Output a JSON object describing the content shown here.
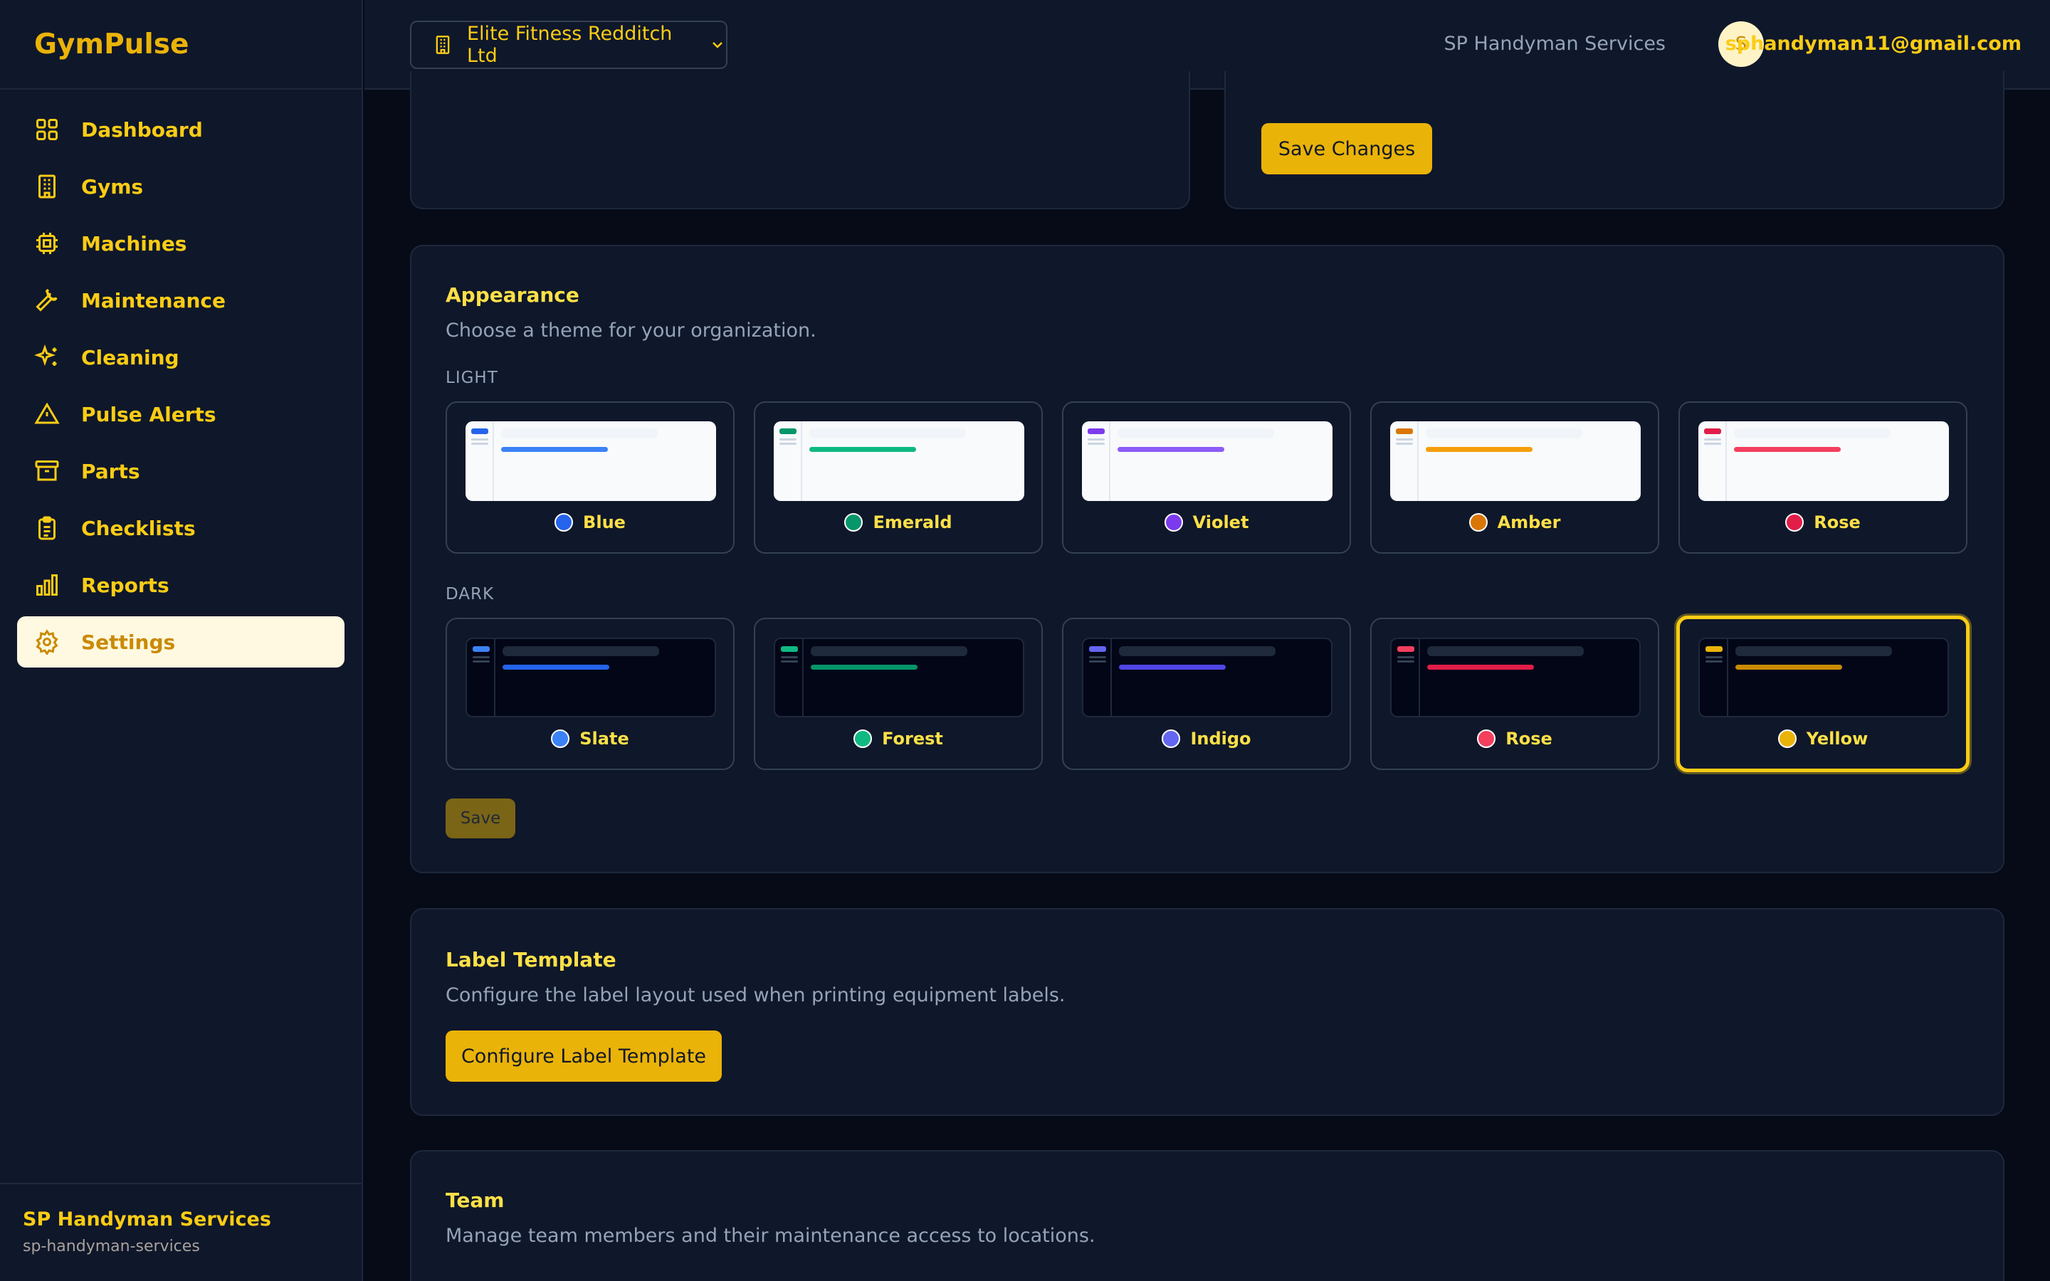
{
  "app": {
    "name": "GymPulse"
  },
  "sidebar": {
    "items": [
      {
        "label": "Dashboard",
        "icon": "grid-icon"
      },
      {
        "label": "Gyms",
        "icon": "building-icon"
      },
      {
        "label": "Machines",
        "icon": "cpu-icon"
      },
      {
        "label": "Maintenance",
        "icon": "wrench-icon"
      },
      {
        "label": "Cleaning",
        "icon": "sparkles-icon"
      },
      {
        "label": "Pulse Alerts",
        "icon": "alert-triangle-icon"
      },
      {
        "label": "Parts",
        "icon": "archive-icon"
      },
      {
        "label": "Checklists",
        "icon": "clipboard-icon"
      },
      {
        "label": "Reports",
        "icon": "bar-chart-icon"
      },
      {
        "label": "Settings",
        "icon": "gear-icon",
        "active": true
      }
    ],
    "footer": {
      "name": "SP Handyman Services",
      "slug": "sp-handyman-services"
    }
  },
  "header": {
    "org_selector": "Elite Fitness Redditch Ltd",
    "company": "SP Handyman Services",
    "avatar_initial": "S",
    "email": "sphandyman11@gmail.com"
  },
  "profile_card": {
    "save_label": "Save Changes"
  },
  "appearance": {
    "title": "Appearance",
    "description": "Choose a theme for your organization.",
    "light_label": "LIGHT",
    "dark_label": "DARK",
    "light_themes": [
      {
        "name": "Blue",
        "color": "#2563eb",
        "bar": "#3b82f6"
      },
      {
        "name": "Emerald",
        "color": "#059669",
        "bar": "#10b981"
      },
      {
        "name": "Violet",
        "color": "#7c3aed",
        "bar": "#8b5cf6"
      },
      {
        "name": "Amber",
        "color": "#d97706",
        "bar": "#f59e0b"
      },
      {
        "name": "Rose",
        "color": "#e11d48",
        "bar": "#f43f5e"
      }
    ],
    "dark_themes": [
      {
        "name": "Slate",
        "color": "#3b82f6",
        "bar": "#2563eb"
      },
      {
        "name": "Forest",
        "color": "#10b981",
        "bar": "#059669"
      },
      {
        "name": "Indigo",
        "color": "#6366f1",
        "bar": "#4f46e5"
      },
      {
        "name": "Rose",
        "color": "#f43f5e",
        "bar": "#e11d48"
      },
      {
        "name": "Yellow",
        "color": "#eab308",
        "bar": "#ca8a04",
        "selected": true
      }
    ],
    "save_label": "Save"
  },
  "label_template": {
    "title": "Label Template",
    "description": "Configure the label layout used when printing equipment labels.",
    "button_label": "Configure Label Template"
  },
  "team": {
    "title": "Team",
    "description": "Manage team members and their maintenance access to locations."
  }
}
